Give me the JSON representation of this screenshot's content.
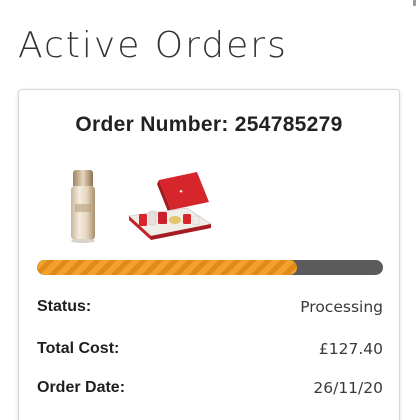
{
  "page": {
    "title": "Active Orders"
  },
  "order": {
    "heading": "Order Number: 254785279",
    "progress_fraction": 0.75,
    "colors": {
      "progress_fill": "#f2a12c",
      "progress_stripe": "#e08a17",
      "progress_track": "#5b5b5b"
    },
    "products": [
      {
        "icon": "serum-bottle-icon"
      },
      {
        "icon": "gift-set-box-icon"
      }
    ],
    "details": [
      {
        "label": "Status:",
        "value": "Processing"
      },
      {
        "label": "Total Cost:",
        "value": "£127.40"
      },
      {
        "label": "Order Date:",
        "value": "26/11/20"
      }
    ]
  }
}
